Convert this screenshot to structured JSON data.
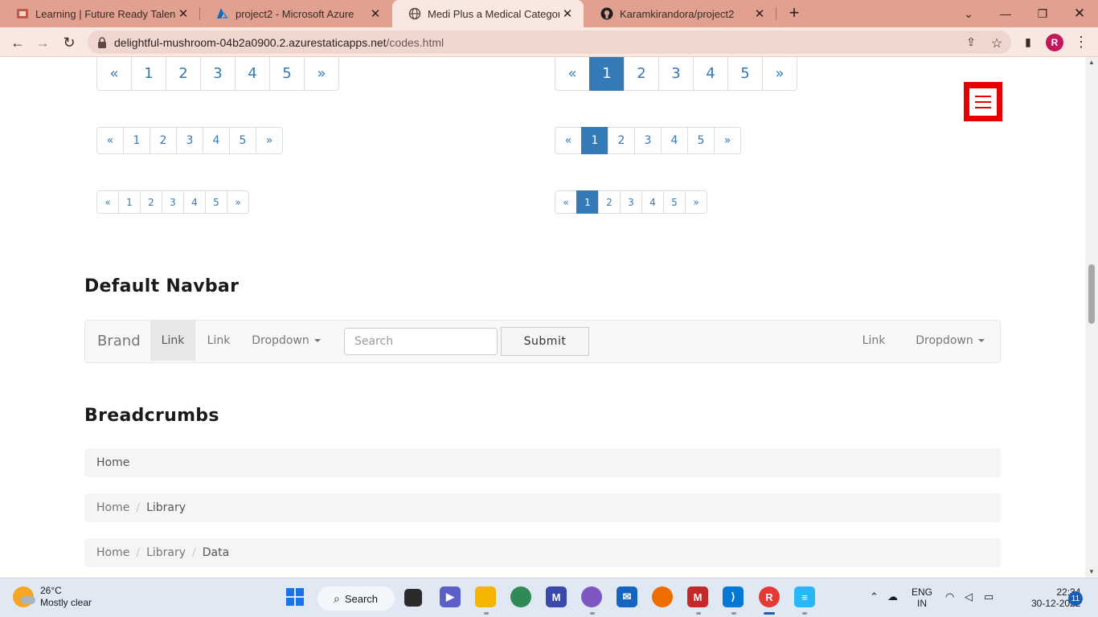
{
  "browser": {
    "tabs": [
      {
        "title": "Learning | Future Ready Talent",
        "active": false
      },
      {
        "title": "project2 - Microsoft Azure",
        "active": false
      },
      {
        "title": "Medi Plus a Medical Category Fla",
        "active": true
      },
      {
        "title": "Karamkirandora/project2",
        "active": false
      }
    ],
    "url_host": "delightful-mushroom-04b2a0900.2.azurestaticapps.net",
    "url_path": "/codes.html",
    "profile_initial": "R"
  },
  "pagination": {
    "prev": "«",
    "next": "»",
    "pages": [
      "1",
      "2",
      "3",
      "4",
      "5"
    ]
  },
  "navbar_section": {
    "title": "Default Navbar",
    "brand": "Brand",
    "link1": "Link",
    "link2": "Link",
    "dropdown": "Dropdown",
    "search_placeholder": "Search",
    "submit": "Submit",
    "right_link": "Link",
    "right_dropdown": "Dropdown"
  },
  "breadcrumbs_section": {
    "title": "Breadcrumbs",
    "crumbs": [
      [
        "Home"
      ],
      [
        "Home",
        "Library"
      ],
      [
        "Home",
        "Library",
        "Data"
      ]
    ]
  },
  "taskbar": {
    "temperature": "26°C",
    "weather": "Mostly clear",
    "search_label": "Search",
    "lang": "ENG",
    "region": "IN",
    "time": "22:34",
    "date": "30-12-2022",
    "notifications": "11"
  },
  "colors": {
    "link_blue": "#337ab7",
    "hamburger_red": "#e60000"
  }
}
